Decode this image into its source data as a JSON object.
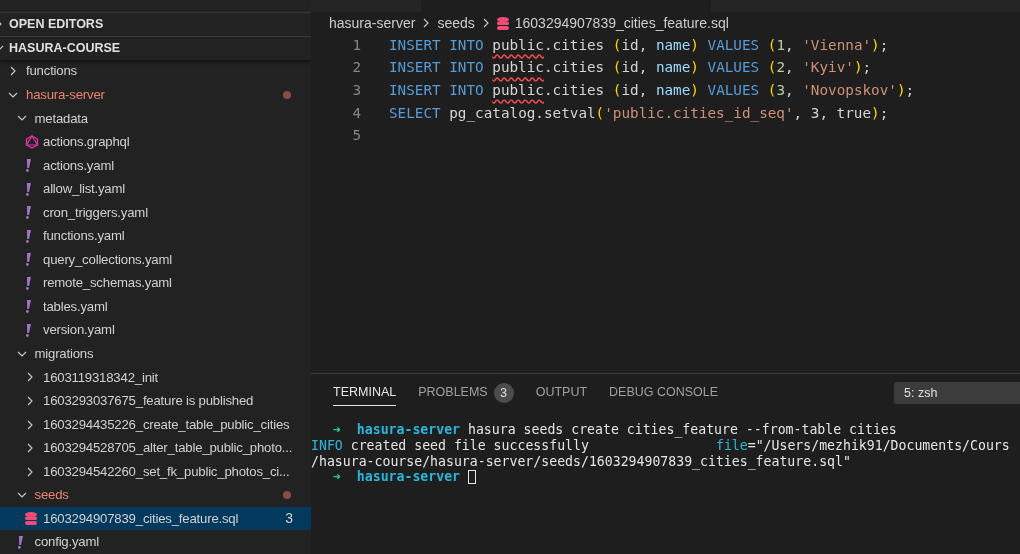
{
  "sidebar": {
    "sections": [
      {
        "title": "OPEN EDITORS",
        "expanded": false
      },
      {
        "title": "HASURA-COURSE",
        "expanded": true
      }
    ],
    "tree": [
      {
        "label": "functions",
        "kind": "folder",
        "expanded": false,
        "modified": false
      },
      {
        "label": "hasura-server",
        "kind": "folder",
        "expanded": true,
        "modified": true,
        "children": [
          {
            "label": "metadata",
            "kind": "folder",
            "expanded": true,
            "modified": false,
            "children": [
              {
                "label": "actions.graphql",
                "kind": "graphql",
                "selected": false
              },
              {
                "label": "actions.yaml",
                "kind": "yaml",
                "selected": false
              },
              {
                "label": "allow_list.yaml",
                "kind": "yaml",
                "selected": false
              },
              {
                "label": "cron_triggers.yaml",
                "kind": "yaml",
                "selected": false
              },
              {
                "label": "functions.yaml",
                "kind": "yaml",
                "selected": false
              },
              {
                "label": "query_collections.yaml",
                "kind": "yaml",
                "selected": false
              },
              {
                "label": "remote_schemas.yaml",
                "kind": "yaml",
                "selected": false
              },
              {
                "label": "tables.yaml",
                "kind": "yaml",
                "selected": false
              },
              {
                "label": "version.yaml",
                "kind": "yaml",
                "selected": false
              }
            ]
          },
          {
            "label": "migrations",
            "kind": "folder",
            "expanded": true,
            "modified": false,
            "children": [
              {
                "label": "1603119318342_init",
                "kind": "folder",
                "expanded": false,
                "modified": false
              },
              {
                "label": "1603293037675_feature is published",
                "kind": "folder",
                "expanded": false,
                "modified": false
              },
              {
                "label": "1603294435226_create_table_public_cities",
                "kind": "folder",
                "expanded": false,
                "modified": false
              },
              {
                "label": "1603294528705_alter_table_public_photo...",
                "kind": "folder",
                "expanded": false,
                "modified": false
              },
              {
                "label": "1603294542260_set_fk_public_photos_ci...",
                "kind": "folder",
                "expanded": false,
                "modified": false
              }
            ]
          },
          {
            "label": "seeds",
            "kind": "folder",
            "expanded": true,
            "modified": true,
            "children": [
              {
                "label": "1603294907839_cities_feature.sql",
                "kind": "sql",
                "selected": true,
                "badge": "3"
              }
            ]
          },
          {
            "label": "config.yaml",
            "kind": "yaml",
            "selected": false
          }
        ]
      }
    ]
  },
  "breadcrumb": [
    {
      "label": "hasura-server",
      "kind": "folder"
    },
    {
      "label": "seeds",
      "kind": "folder"
    },
    {
      "label": "1603294907839_cities_feature.sql",
      "kind": "sql"
    }
  ],
  "editor": {
    "lines": [
      {
        "number": "1",
        "tokens": [
          {
            "text": "INSERT INTO ",
            "kind": "keyword"
          },
          {
            "text": "public",
            "kind": "error"
          },
          {
            "text": ".cities ",
            "kind": "plain"
          },
          {
            "text": "(",
            "kind": "paren"
          },
          {
            "text": "id, ",
            "kind": "plain"
          },
          {
            "text": "name",
            "kind": "field"
          },
          {
            "text": ")",
            "kind": "paren"
          },
          {
            "text": " VALUES ",
            "kind": "keyword"
          },
          {
            "text": "(",
            "kind": "paren"
          },
          {
            "text": "1",
            "kind": "number"
          },
          {
            "text": ", ",
            "kind": "plain"
          },
          {
            "text": "'Vienna'",
            "kind": "string"
          },
          {
            "text": ")",
            "kind": "paren"
          },
          {
            "text": ";",
            "kind": "plain"
          }
        ]
      },
      {
        "number": "2",
        "tokens": [
          {
            "text": "INSERT INTO ",
            "kind": "keyword"
          },
          {
            "text": "public",
            "kind": "error"
          },
          {
            "text": ".cities ",
            "kind": "plain"
          },
          {
            "text": "(",
            "kind": "paren"
          },
          {
            "text": "id, ",
            "kind": "plain"
          },
          {
            "text": "name",
            "kind": "field"
          },
          {
            "text": ")",
            "kind": "paren"
          },
          {
            "text": " VALUES ",
            "kind": "keyword"
          },
          {
            "text": "(",
            "kind": "paren"
          },
          {
            "text": "2",
            "kind": "number"
          },
          {
            "text": ", ",
            "kind": "plain"
          },
          {
            "text": "'Kyiv'",
            "kind": "string"
          },
          {
            "text": ")",
            "kind": "paren"
          },
          {
            "text": ";",
            "kind": "plain"
          }
        ]
      },
      {
        "number": "3",
        "tokens": [
          {
            "text": "INSERT INTO ",
            "kind": "keyword"
          },
          {
            "text": "public",
            "kind": "error"
          },
          {
            "text": ".cities ",
            "kind": "plain"
          },
          {
            "text": "(",
            "kind": "paren"
          },
          {
            "text": "id, ",
            "kind": "plain"
          },
          {
            "text": "name",
            "kind": "field"
          },
          {
            "text": ")",
            "kind": "paren"
          },
          {
            "text": " VALUES ",
            "kind": "keyword"
          },
          {
            "text": "(",
            "kind": "paren"
          },
          {
            "text": "3",
            "kind": "number"
          },
          {
            "text": ", ",
            "kind": "plain"
          },
          {
            "text": "'Novopskov'",
            "kind": "string"
          },
          {
            "text": ")",
            "kind": "paren"
          },
          {
            "text": ";",
            "kind": "plain"
          }
        ]
      },
      {
        "number": "4",
        "tokens": [
          {
            "text": "SELECT ",
            "kind": "keyword"
          },
          {
            "text": "pg_catalog.setval",
            "kind": "plain"
          },
          {
            "text": "(",
            "kind": "paren"
          },
          {
            "text": "'public.cities_id_seq'",
            "kind": "string"
          },
          {
            "text": ", 3, true",
            "kind": "plain"
          },
          {
            "text": ")",
            "kind": "paren"
          },
          {
            "text": ";",
            "kind": "plain"
          }
        ]
      },
      {
        "number": "5"
      }
    ]
  },
  "panel": {
    "tabs": [
      {
        "label": "TERMINAL",
        "selected": true
      },
      {
        "label": "PROBLEMS",
        "selected": false,
        "badge": "3"
      },
      {
        "label": "OUTPUT",
        "selected": false
      },
      {
        "label": "DEBUG CONSOLE",
        "selected": false
      }
    ],
    "terminal_select": "5: zsh",
    "terminal_lines": [
      [
        {
          "text": "➜  ",
          "kind": "arrow"
        },
        {
          "text": "hasura-server",
          "kind": "prompt"
        },
        {
          "text": " hasura seeds create cities_feature --from-table cities",
          "kind": "plain"
        }
      ],
      [
        {
          "text": "INFO",
          "kind": "info"
        },
        {
          "text": " created seed file successfully                ",
          "kind": "plain"
        },
        {
          "text": "file",
          "kind": "info"
        },
        {
          "text": "=\"/Users/mezhik91/Documents/Cours",
          "kind": "plain"
        }
      ],
      [
        {
          "text": "/hasura-course/hasura-server/seeds/1603294907839_cities_feature.sql\"",
          "kind": "plain"
        }
      ],
      [
        {
          "text": "➜  ",
          "kind": "arrow"
        },
        {
          "text": "hasura-server",
          "kind": "prompt"
        },
        {
          "kind": "cursor"
        }
      ]
    ]
  }
}
